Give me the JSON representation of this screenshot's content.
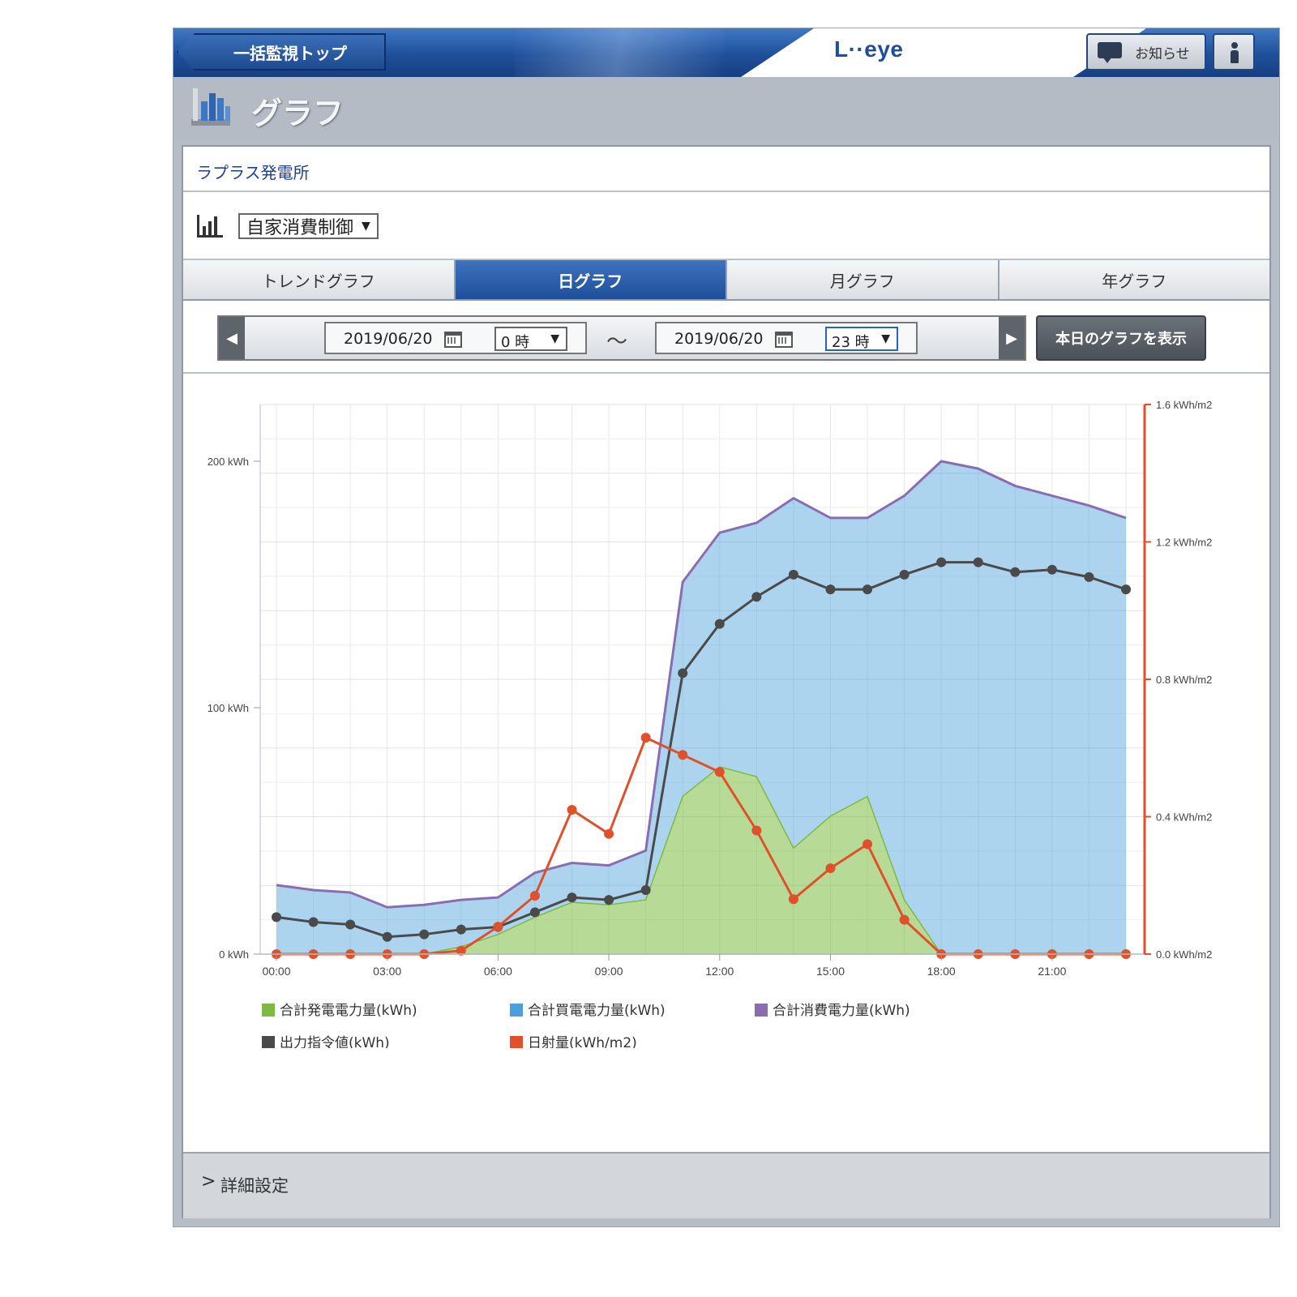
{
  "header": {
    "back_label": "一括監視トップ",
    "logo": "L··eye",
    "notice_label": "お知らせ"
  },
  "page": {
    "title": "グラフ"
  },
  "site": {
    "name": "ラプラス発電所"
  },
  "mode_select": {
    "value": "自家消費制御"
  },
  "tabs": [
    {
      "label": "トレンドグラフ",
      "active": false
    },
    {
      "label": "日グラフ",
      "active": true
    },
    {
      "label": "月グラフ",
      "active": false
    },
    {
      "label": "年グラフ",
      "active": false
    }
  ],
  "date_range": {
    "from_date": "2019/06/20",
    "from_hour": "0 時",
    "separator": "〜",
    "to_date": "2019/06/20",
    "to_hour": "23 時",
    "today_button": "本日のグラフを表示"
  },
  "details": {
    "label": "詳細設定"
  },
  "colors": {
    "accent_blue": "#1f4f99",
    "generation": "#7cbb3f",
    "purchase": "#4a9fdc",
    "consumption": "#8a6db0",
    "output_command": "#4a4a4a",
    "irradiance": "#e0502a"
  },
  "chart_data": {
    "type": "area",
    "x_ticks": [
      "00:00",
      "03:00",
      "06:00",
      "09:00",
      "12:00",
      "15:00",
      "18:00",
      "21:00"
    ],
    "x_hours": [
      0,
      1,
      2,
      3,
      4,
      5,
      6,
      7,
      8,
      9,
      10,
      11,
      12,
      13,
      14,
      15,
      16,
      17,
      18,
      19,
      20,
      21,
      22,
      23
    ],
    "y_left": {
      "ticks": [
        "0 kWh",
        "100 kWh",
        "200 kWh"
      ],
      "range": [
        0,
        200
      ],
      "tick_values": [
        0,
        100,
        200
      ]
    },
    "y_right": {
      "ticks": [
        "0.0 kWh/m2",
        "0.4 kWh/m2",
        "0.8 kWh/m2",
        "1.2 kWh/m2",
        "1.6 kWh/m2"
      ],
      "range": [
        0,
        1.6
      ],
      "tick_values": [
        0,
        0.4,
        0.8,
        1.2,
        1.6
      ]
    },
    "grid": true,
    "series": [
      {
        "name": "合計発電電力量(kWh)",
        "kind": "area",
        "axis": "left",
        "values": [
          0,
          0,
          0,
          0,
          0,
          3,
          8,
          15,
          21,
          20,
          22,
          64,
          76,
          72,
          43,
          56,
          64,
          22,
          0,
          0,
          0,
          0,
          0,
          0
        ]
      },
      {
        "name": "合計買電電力量(kWh)",
        "kind": "area",
        "axis": "left",
        "values": [
          28,
          26,
          25,
          19,
          20,
          19,
          15,
          18,
          16,
          16,
          20,
          87,
          95,
          103,
          142,
          120,
          113,
          165,
          200,
          197,
          190,
          186,
          182,
          177
        ]
      },
      {
        "name": "合計消費電力量(kWh)",
        "kind": "line",
        "axis": "left",
        "values": [
          28,
          26,
          25,
          19,
          20,
          22,
          23,
          33,
          37,
          36,
          42,
          151,
          171,
          175,
          185,
          177,
          177,
          186,
          200,
          197,
          190,
          186,
          182,
          177
        ]
      },
      {
        "name": "出力指令値(kWh)",
        "kind": "line-marker",
        "axis": "left",
        "values": [
          15,
          13,
          12,
          7,
          8,
          10,
          11,
          17,
          23,
          22,
          26,
          114,
          134,
          145,
          154,
          148,
          148,
          154,
          159,
          159,
          155,
          156,
          153,
          148
        ]
      },
      {
        "name": "日射量(kWh/m2)",
        "kind": "line-marker",
        "axis": "right",
        "values": [
          0,
          0,
          0,
          0,
          0,
          0.01,
          0.08,
          0.17,
          0.42,
          0.35,
          0.63,
          0.58,
          0.53,
          0.36,
          0.16,
          0.25,
          0.32,
          0.1,
          0,
          0,
          0,
          0,
          0,
          0
        ]
      }
    ]
  }
}
